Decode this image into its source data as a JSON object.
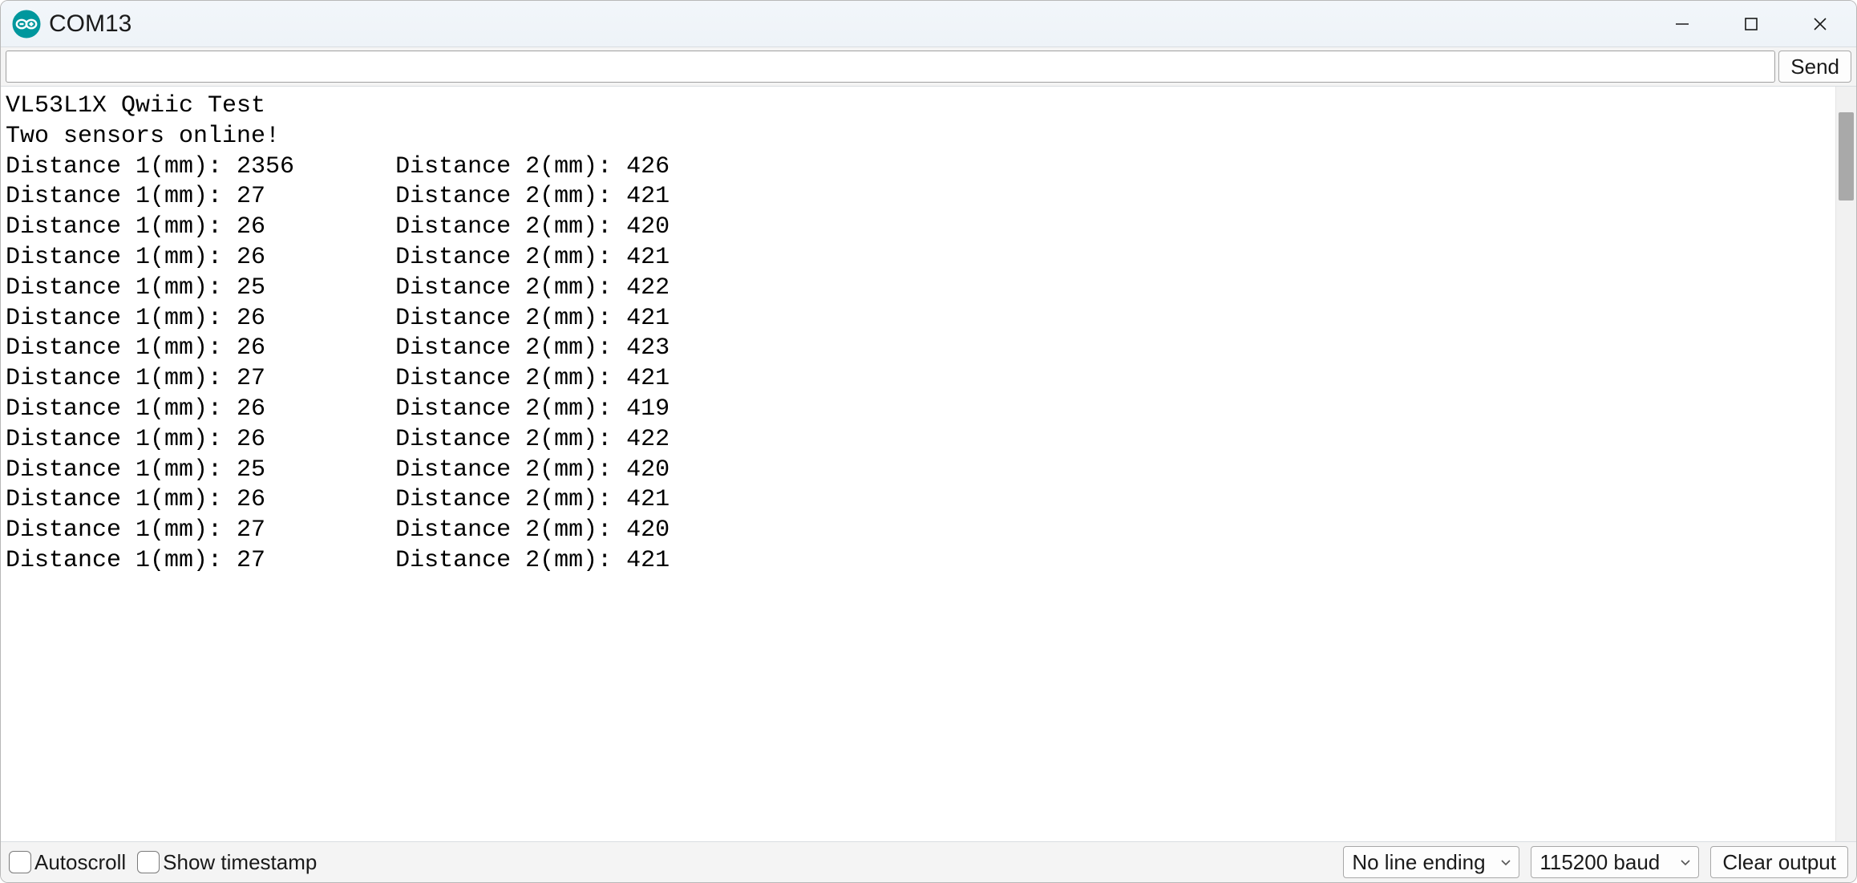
{
  "window": {
    "title": "COM13"
  },
  "toolbar": {
    "send_label": "Send",
    "input_value": ""
  },
  "serial": {
    "header1": "VL53L1X Qwiic Test",
    "header2": "Two sensors online!",
    "label1": "Distance 1(mm): ",
    "label2": "Distance 2(mm): ",
    "rows": [
      {
        "d1": 2356,
        "d2": 426
      },
      {
        "d1": 27,
        "d2": 421
      },
      {
        "d1": 26,
        "d2": 420
      },
      {
        "d1": 26,
        "d2": 421
      },
      {
        "d1": 25,
        "d2": 422
      },
      {
        "d1": 26,
        "d2": 421
      },
      {
        "d1": 26,
        "d2": 423
      },
      {
        "d1": 27,
        "d2": 421
      },
      {
        "d1": 26,
        "d2": 419
      },
      {
        "d1": 26,
        "d2": 422
      },
      {
        "d1": 25,
        "d2": 420
      },
      {
        "d1": 26,
        "d2": 421
      },
      {
        "d1": 27,
        "d2": 420
      },
      {
        "d1": 27,
        "d2": 421
      }
    ]
  },
  "footer": {
    "autoscroll_label": "Autoscroll",
    "autoscroll_checked": false,
    "timestamp_label": "Show timestamp",
    "timestamp_checked": false,
    "line_ending_selected": "No line ending",
    "baud_selected": "115200 baud",
    "clear_label": "Clear output"
  },
  "colors": {
    "arduino_teal": "#00979D"
  }
}
